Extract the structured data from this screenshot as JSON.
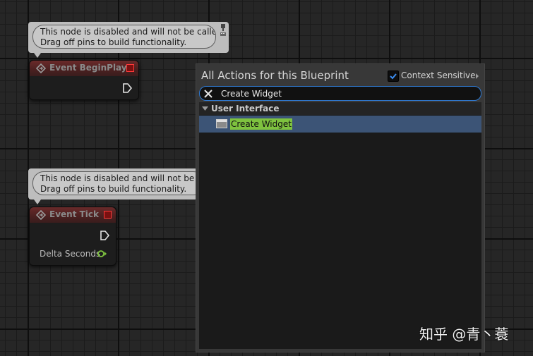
{
  "graph": {
    "begin_play_comment": {
      "line1": "This node is disabled and will not be called.",
      "line2": "Drag off pins to build functionality."
    },
    "tick_comment": {
      "line1": "This node is disabled and will not be called.",
      "line2": "Drag off pins to build functionality."
    },
    "begin_play_node": {
      "title": "Event BeginPlay"
    },
    "tick_node": {
      "title": "Event Tick",
      "delta_label": "Delta Seconds"
    }
  },
  "action_menu": {
    "title": "All Actions for this Blueprint",
    "context_sensitive_label": "Context Sensitive",
    "context_sensitive_checked": true,
    "search_value": "Create Widget",
    "category": "User Interface",
    "items": [
      {
        "label": "Create Widget",
        "icon": "widget-icon",
        "selected": true
      }
    ]
  },
  "watermark": "知乎 @青丶蓑",
  "colors": {
    "accent_blue": "#2f7ad3",
    "selection": "#3c5476",
    "highlight_green": "#7ec23f",
    "event_header": "#6a2a2a",
    "float_pin": "#7ec23f"
  }
}
